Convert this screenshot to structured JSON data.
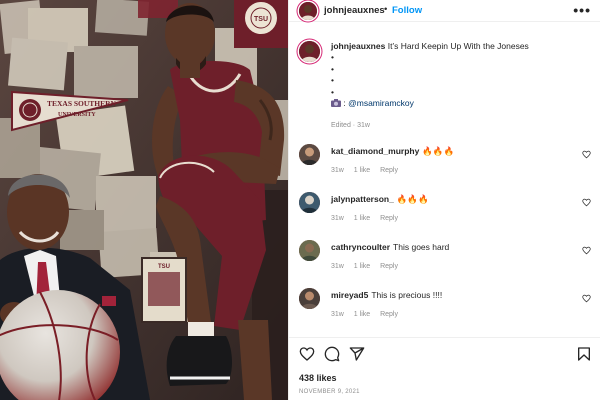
{
  "header": {
    "username": "johnjeauxnes",
    "separator": "•",
    "follow_label": "Follow",
    "more_label": "•••"
  },
  "photo": {
    "pennant_line1": "TEXAS SOUTHERN",
    "pennant_line2": "UNIVERSITY",
    "seal_text": "TEXAS SOUTHERN UNIVERSITY",
    "tsu_text": "TSU"
  },
  "caption": {
    "username": "johnjeauxnes",
    "text": "It’s Hard Keepin Up With the Joneses",
    "bullets": [
      "•",
      "•",
      "•",
      "•"
    ],
    "photo_credit_icon": "camera-icon",
    "photo_credit_sep": ":",
    "mention": "@msamiramckoy",
    "meta": "Edited · 31w"
  },
  "comments": [
    {
      "username": "kat_diamond_murphy",
      "text": "🔥🔥🔥",
      "age": "31w",
      "likes": "1 like",
      "reply": "Reply",
      "avatar_color": "#5b4a42"
    },
    {
      "username": "jalynpatterson_",
      "text": "🔥🔥🔥",
      "age": "31w",
      "likes": "1 like",
      "reply": "Reply",
      "avatar_color": "#3d5a6e"
    },
    {
      "username": "cathryncoulter",
      "text": "This goes hard",
      "age": "31w",
      "likes": "1 like",
      "reply": "Reply",
      "avatar_color": "#6b6b4f"
    },
    {
      "username": "mireyad5",
      "text": "This is precious !!!!",
      "age": "31w",
      "likes": "1 like",
      "reply": "Reply",
      "avatar_color": "#4a3f3a"
    }
  ],
  "footer": {
    "likes": "438 likes",
    "date": "NOVEMBER 9, 2021"
  },
  "icons": {
    "heart": "heart-icon",
    "comment": "comment-icon",
    "share": "share-icon",
    "save": "bookmark-icon"
  },
  "colors": {
    "link_blue": "#0095f6",
    "mention": "#00376b",
    "muted": "#8e8e8e",
    "maroon": "#6e1f2a"
  }
}
